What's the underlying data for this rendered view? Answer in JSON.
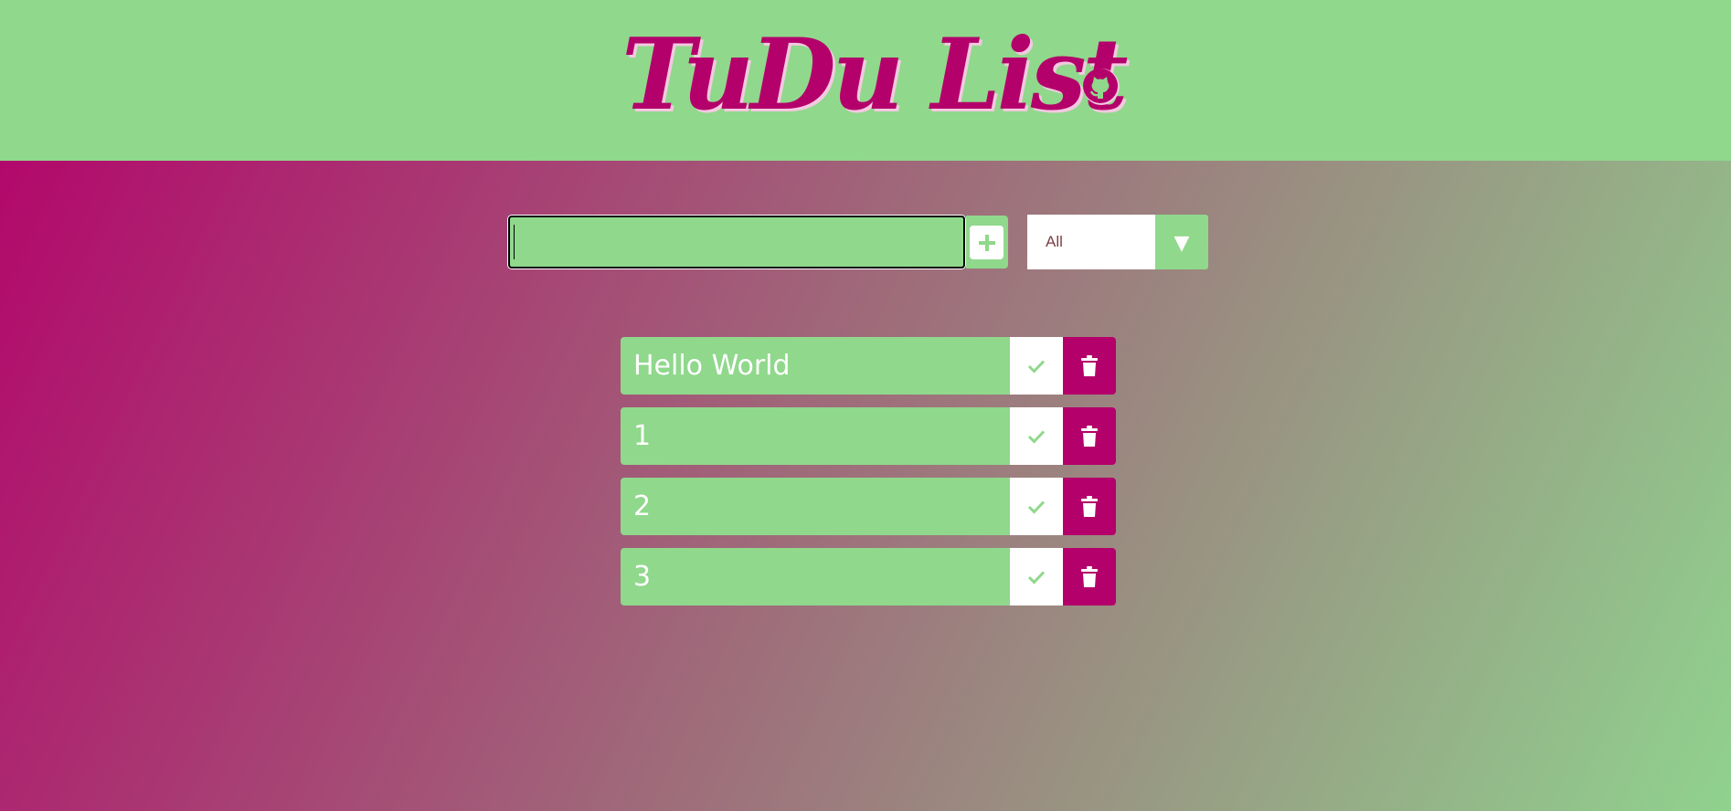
{
  "header": {
    "title": "TuDu List",
    "github_icon": "github-icon"
  },
  "form": {
    "input_value": "",
    "add_icon": "plus-icon",
    "filter": {
      "selected": "All",
      "arrow": "▼"
    }
  },
  "todos": [
    {
      "text": "Hello World"
    },
    {
      "text": "1"
    },
    {
      "text": "2"
    },
    {
      "text": "3"
    }
  ],
  "colors": {
    "green": "#90d88c",
    "magenta": "#b4006a",
    "white": "#ffffff"
  }
}
